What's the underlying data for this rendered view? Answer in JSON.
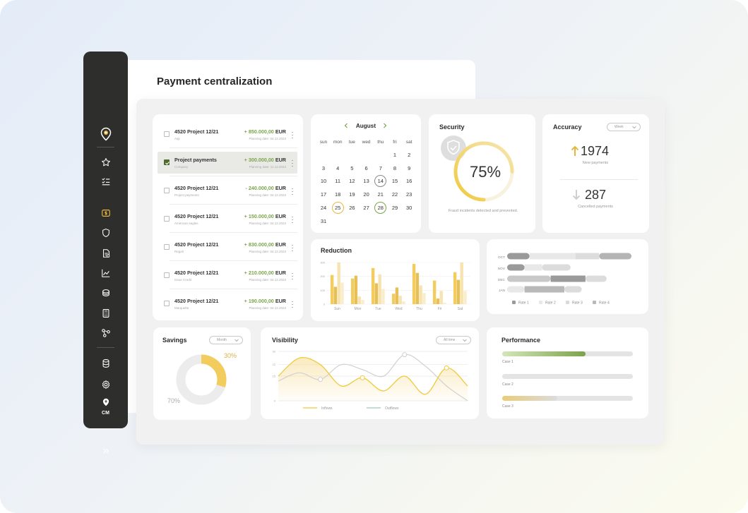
{
  "page": {
    "title": "Payment centralization"
  },
  "sidebar": {
    "items": [
      {
        "icon": "location-pin-icon"
      },
      {
        "icon": "star-icon"
      },
      {
        "icon": "checklist-icon"
      },
      {
        "icon": "payments-icon",
        "active": true
      },
      {
        "icon": "shield-icon"
      },
      {
        "icon": "document-icon"
      },
      {
        "icon": "analytics-icon"
      },
      {
        "icon": "coins-icon"
      },
      {
        "icon": "calculator-icon"
      },
      {
        "icon": "workflow-icon"
      },
      {
        "icon": "database-icon"
      },
      {
        "icon": "settings-icon"
      },
      {
        "icon": "cm-icon"
      },
      {
        "icon": "expand-icon"
      }
    ],
    "cm_label": "CM",
    "accent_color": "#e8b640"
  },
  "payments": [
    {
      "name": "4520 Project 12/21",
      "sub": "Aaji",
      "sign": "+",
      "amount": "850.000,00",
      "currency": "EUR",
      "date": "Planning date: 04.12.2023",
      "checked": false
    },
    {
      "name": "Project payments",
      "sub": "Company",
      "sign": "+",
      "amount": "300.000,00",
      "currency": "EUR",
      "date": "Planning date: 11.12.2023",
      "checked": true
    },
    {
      "name": "4520 Project 12/21",
      "sub": "Project payments",
      "sign": "-",
      "amount": "240.000,00",
      "currency": "EUR",
      "date": "Planning date: 04.12.2023",
      "checked": false
    },
    {
      "name": "4520 Project 12/21",
      "sub": "American eagles",
      "sign": "+",
      "amount": "150.000,00",
      "currency": "EUR",
      "date": "Planning date: 04.12.2023",
      "checked": false
    },
    {
      "name": "4520 Project 12/21",
      "sub": "Regali",
      "sign": "+",
      "amount": "830.000,00",
      "currency": "EUR",
      "date": "Planning date: 04.12.2023",
      "checked": false
    },
    {
      "name": "4520 Project 12/21",
      "sub": "Issue Credit",
      "sign": "+",
      "amount": "210.000,00",
      "currency": "EUR",
      "date": "Planning date: 04.12.2023",
      "checked": false
    },
    {
      "name": "4520 Project 12/21",
      "sub": "Marquette",
      "sign": "+",
      "amount": "190.000,00",
      "currency": "EUR",
      "date": "Planning date: 04.12.2023",
      "checked": false
    }
  ],
  "calendar": {
    "month": "August",
    "weekdays": [
      "sun",
      "mon",
      "tue",
      "wed",
      "thu",
      "fri",
      "sat"
    ],
    "start_offset": 5,
    "days": 31,
    "ringed": [
      {
        "day": 14,
        "color": "#8a8a8a"
      },
      {
        "day": 25,
        "color": "#e8b640"
      },
      {
        "day": 28,
        "color": "#7aa349"
      }
    ]
  },
  "security": {
    "title": "Security",
    "percent": "75%",
    "value": 0.75,
    "subtitle": "Fraud incidents detected and prevented."
  },
  "accuracy": {
    "title": "Accuracy",
    "filter": "Week",
    "new_value": "1974",
    "new_label": "New payments",
    "cancel_value": "287",
    "cancel_label": "Cancelled payments"
  },
  "reduction": {
    "title": "Reduction",
    "chart_data": {
      "type": "bar",
      "categories": [
        "Sun",
        "Mon",
        "Tue",
        "Wed",
        "Thu",
        "Fri",
        "Sat"
      ],
      "yticks": [
        "300",
        "200",
        "100",
        "0"
      ],
      "ylim": [
        0,
        300
      ],
      "series": [
        {
          "values": [
            210,
            185,
            260,
            75,
            290,
            170,
            230
          ],
          "color": "#f2cd5e"
        },
        {
          "values": [
            125,
            205,
            150,
            120,
            225,
            40,
            175
          ],
          "color": "#e6c056"
        },
        {
          "values": [
            300,
            55,
            215,
            60,
            135,
            95,
            300
          ],
          "color": "#f6e3b0"
        },
        {
          "values": [
            155,
            30,
            110,
            20,
            80,
            10,
            95
          ],
          "color": "#faedcc"
        }
      ]
    }
  },
  "rates": {
    "chart_data": {
      "type": "bar",
      "orientation": "horizontal",
      "categories": [
        "OCT",
        "NOV",
        "DEC",
        "JAN"
      ],
      "series": [
        {
          "name": "Rate 1",
          "color": "#9a9a9a",
          "values": [
            [
              0,
              0.18
            ]
          ]
        },
        {
          "name": "Rate 2",
          "color": "#e8e8e8",
          "values": [
            [
              0.18,
              0.55
            ]
          ]
        },
        {
          "name": "Rate 3",
          "color": "#dadada",
          "values": [
            [
              0.55,
              0.75
            ]
          ]
        },
        {
          "name": "Rate 4",
          "color": "#b8b8b8",
          "values": [
            [
              0.75,
              1.0
            ]
          ]
        }
      ],
      "rows": [
        [
          {
            "s": 0,
            "e": 0.18,
            "c": "#9a9a9a"
          },
          {
            "s": 0.18,
            "e": 0.55,
            "c": "#e8e8e8"
          },
          {
            "s": 0.55,
            "e": 0.74,
            "c": "#dcdcdc"
          },
          {
            "s": 0.74,
            "e": 1.0,
            "c": "#b4b4b4"
          }
        ],
        [
          {
            "s": 0,
            "e": 0.14,
            "c": "#9a9a9a"
          },
          {
            "s": 0.14,
            "e": 0.28,
            "c": "#e8e8e8"
          },
          {
            "s": 0.28,
            "e": 0.51,
            "c": "#dcdcdc"
          }
        ],
        [
          {
            "s": 0,
            "e": 0.35,
            "c": "#c8c8c8"
          },
          {
            "s": 0.35,
            "e": 0.63,
            "c": "#9a9a9a"
          },
          {
            "s": 0.63,
            "e": 0.8,
            "c": "#dcdcdc"
          }
        ],
        [
          {
            "s": 0,
            "e": 0.14,
            "c": "#e8e8e8"
          },
          {
            "s": 0.14,
            "e": 0.46,
            "c": "#b8b8b8"
          },
          {
            "s": 0.46,
            "e": 0.6,
            "c": "#dcdcdc"
          }
        ]
      ]
    }
  },
  "savings": {
    "title": "Savings",
    "filter": "Month",
    "chart_data": {
      "type": "pie",
      "values": [
        30,
        70
      ],
      "labels": [
        "30%",
        "70%"
      ],
      "colors": [
        "#f2cd5e",
        "#ececec"
      ]
    }
  },
  "visibility": {
    "title": "Visibility",
    "filter": "All time",
    "chart_data": {
      "type": "line",
      "yticks": [
        "30",
        "22",
        "15",
        "0"
      ],
      "ylim": [
        0,
        30
      ],
      "series": [
        {
          "name": "Inflows",
          "color": "#f0c93e",
          "values": [
            15,
            26,
            22,
            9,
            14,
            6,
            15,
            4,
            20,
            9
          ]
        },
        {
          "name": "Outflows",
          "color": "#d0d0d0",
          "values": [
            12,
            17,
            13,
            22,
            19,
            15,
            28,
            21,
            9,
            0
          ]
        }
      ]
    }
  },
  "performance": {
    "title": "Performance",
    "cases": [
      {
        "label": "Case 1",
        "value": 0.64,
        "color_from": "#d5e6b8",
        "color_to": "#7aa349"
      },
      {
        "label": "Case 2",
        "value": 0.0,
        "color_from": "#e4e4e4",
        "color_to": "#e4e4e4"
      },
      {
        "label": "Case 3",
        "value": 0.42,
        "color_from": "#eacb7a",
        "color_to": "#dcdcdc"
      }
    ]
  }
}
